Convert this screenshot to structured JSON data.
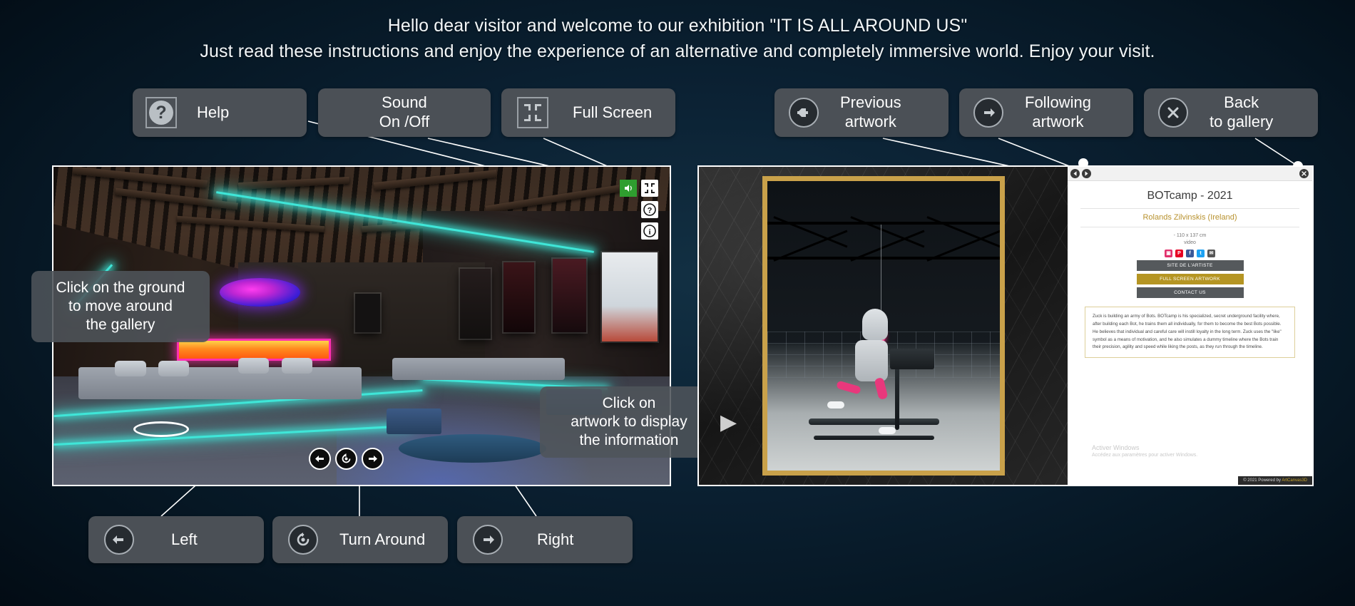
{
  "header": {
    "line1": "Hello dear visitor and welcome to our exhibition \"IT IS ALL AROUND US\"",
    "line2": "Just read these instructions and enjoy the experience of an alternative and completely immersive world. Enjoy your visit."
  },
  "buttons": {
    "help": {
      "label": "Help",
      "icon": "question-mark-icon"
    },
    "sound": {
      "label": "Sound\nOn /Off",
      "icon": "speaker-icon"
    },
    "fullscreen": {
      "label": "Full Screen",
      "icon": "full-screen-icon"
    },
    "previous": {
      "label": "Previous\nartwork",
      "icon": "arrow-left-icon"
    },
    "following": {
      "label": "Following\nartwork",
      "icon": "arrow-right-icon"
    },
    "back": {
      "label": "Back\nto gallery",
      "icon": "close-x-icon"
    },
    "left": {
      "label": "Left",
      "icon": "arrow-left-icon"
    },
    "turn_around": {
      "label": "Turn Around",
      "icon": "rotate-icon"
    },
    "right": {
      "label": "Right",
      "icon": "arrow-right-icon"
    }
  },
  "tooltips": {
    "ground": "Click on the ground\nto move around\nthe gallery",
    "artwork": "Click on\nartwork to display\nthe information"
  },
  "gallery_controls": {
    "sound_glyph": "▶",
    "fullscreen_glyph": "✥",
    "help_glyph": "?",
    "info_glyph": "i",
    "nav_left_glyph": "←",
    "nav_turn_glyph": "↺",
    "nav_right_glyph": "→"
  },
  "artwork": {
    "title": "BOTcamp - 2021",
    "artist": "Rolands Zilvinskis (Ireland)",
    "dimensions": "- 110 x 137 cm",
    "medium": "video",
    "social": [
      {
        "name": "instagram-icon",
        "glyph": "▣",
        "color": "#e1306c"
      },
      {
        "name": "pinterest-icon",
        "glyph": "P",
        "color": "#e60023"
      },
      {
        "name": "facebook-icon",
        "glyph": "f",
        "color": "#3b5998"
      },
      {
        "name": "twitter-icon",
        "glyph": "t",
        "color": "#1da1f2"
      },
      {
        "name": "email-icon",
        "glyph": "✉",
        "color": "#555555"
      }
    ],
    "actions": [
      {
        "label": "SITE DE L'ARTISTE",
        "style": "grey"
      },
      {
        "label": "FULL SCREEN ARTWORK",
        "style": "gold"
      },
      {
        "label": "CONTACT US",
        "style": "grey"
      }
    ],
    "description": "Zuck is building an army of Bots. BOTcamp is his specialized, secret underground facility where, after building each Bot, he trains them all individually, for them to become the best Bots possible. He believes that individual and careful care will instill loyalty in the long term. Zuck uses the \"like\" symbol as a means of motivation, and he also simulates a dummy timeline where the Bots train their precision, agility and speed while liking the posts, as they run through the timeline."
  },
  "windows_watermark": {
    "line1": "Activer Windows",
    "line2": "Accédez aux paramètres pour activer Windows."
  },
  "footer": {
    "copyright": "© 2021 Powered by ",
    "brand": "ArtCanvas3D"
  },
  "colors": {
    "background": "#0b2133",
    "button": "#4b5056",
    "accent_gold": "#b59523",
    "neon": "#3fe6d8",
    "sound_green": "#2f9e2f"
  }
}
